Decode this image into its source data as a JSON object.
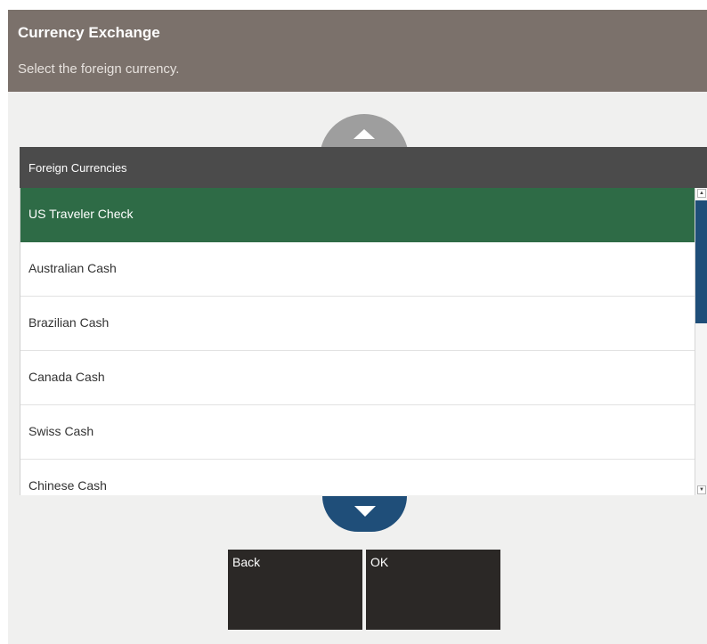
{
  "header": {
    "title": "Currency Exchange",
    "subtitle": "Select the foreign currency."
  },
  "list": {
    "header": "Foreign Currencies",
    "selected_index": 0,
    "items": [
      {
        "label": "US Traveler Check"
      },
      {
        "label": "Australian Cash"
      },
      {
        "label": "Brazilian Cash"
      },
      {
        "label": "Canada Cash"
      },
      {
        "label": "Swiss Cash"
      },
      {
        "label": "Chinese Cash"
      }
    ]
  },
  "buttons": {
    "back": "Back",
    "ok": "OK"
  },
  "icons": {
    "scroll_up": "triangle-up-icon",
    "scroll_down": "triangle-down-icon"
  },
  "colors": {
    "header_bg": "#7b716b",
    "selected_row": "#2e6b46",
    "list_header_bg": "#4b4b4b",
    "scroll_down_bg": "#1f4e79",
    "button_bg": "#2b2826"
  }
}
